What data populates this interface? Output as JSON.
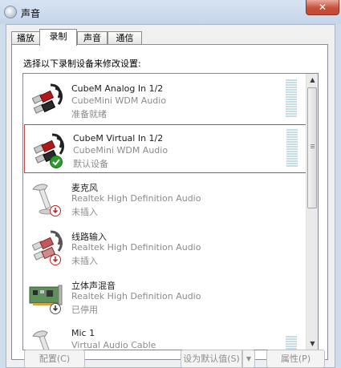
{
  "window": {
    "title": "声音",
    "close_label": "✕"
  },
  "tabs": [
    {
      "label": "播放"
    },
    {
      "label": "录制"
    },
    {
      "label": "声音"
    },
    {
      "label": "通信"
    }
  ],
  "instruction": "选择以下录制设备来修改设置:",
  "devices": [
    {
      "name": "CubeM Analog In 1/2",
      "driver": "CubeMini WDM Audio",
      "status": "准备就绪",
      "icon": "rca-cable-icon"
    },
    {
      "name": "CubeM Virtual In 1/2",
      "driver": "CubeMini WDM Audio",
      "status": "默认设备",
      "icon": "rca-cable-icon",
      "badge": "default-check-icon"
    },
    {
      "name": "麦克风",
      "driver": "Realtek High Definition Audio",
      "status": "未插入",
      "icon": "microphone-icon",
      "badge": "unplugged-icon"
    },
    {
      "name": "线路输入",
      "driver": "Realtek High Definition Audio",
      "status": "未插入",
      "icon": "rca-cable-icon",
      "badge": "unplugged-icon"
    },
    {
      "name": "立体声混音",
      "driver": "Realtek High Definition Audio",
      "status": "已停用",
      "icon": "sound-card-icon",
      "badge": "disabled-icon"
    },
    {
      "name": "Mic 1",
      "driver": "Virtual Audio Cable",
      "status": "",
      "icon": "microphone-icon"
    }
  ],
  "buttons": {
    "configure": "配置(C)",
    "set_default": "设为默认值(S)",
    "properties": "属性(P)"
  },
  "colors": {
    "selection_border": "#c4473c",
    "default_check": "#2c9b2c",
    "level_meter": "#c7dde6"
  }
}
